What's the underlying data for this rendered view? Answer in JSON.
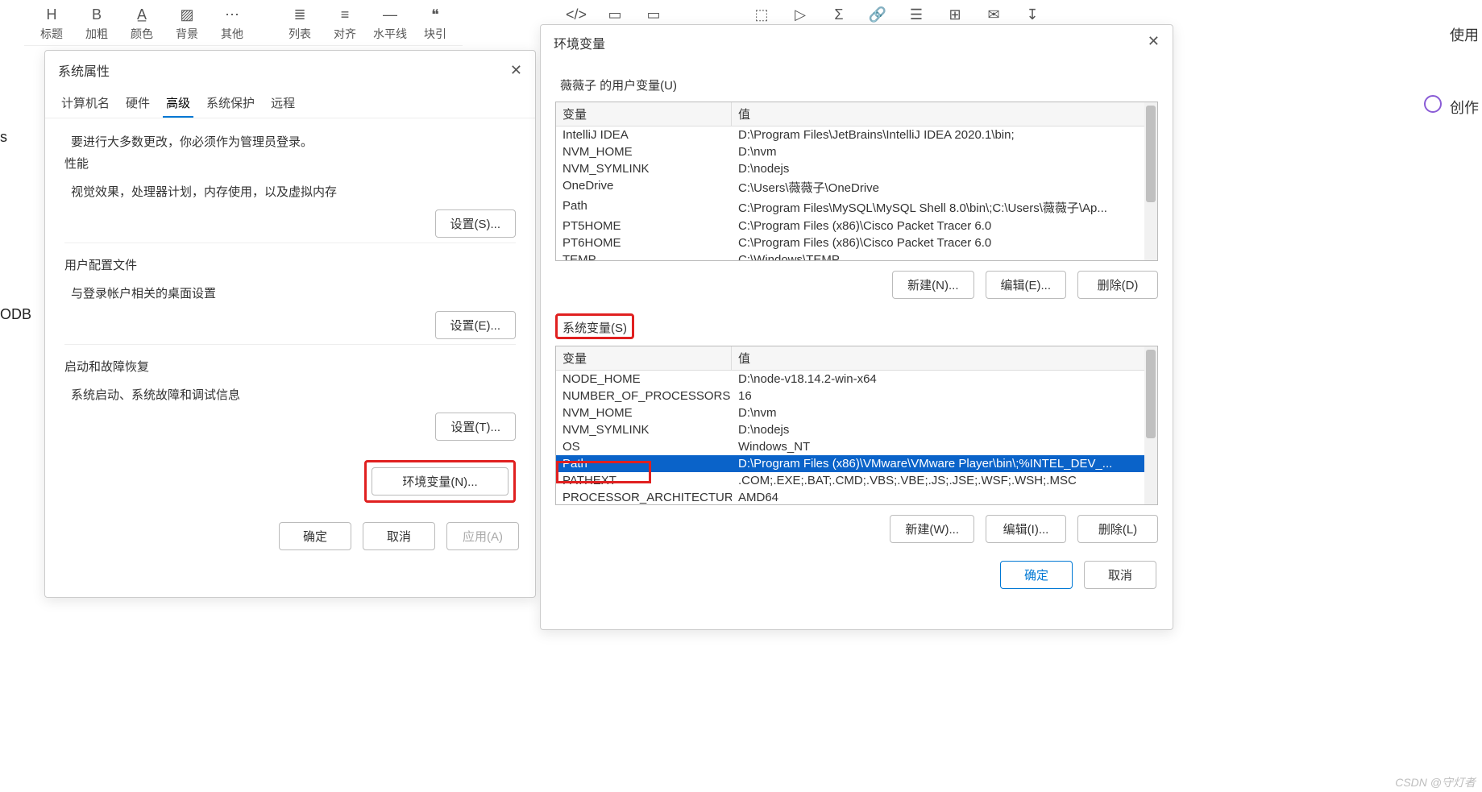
{
  "toolbar_left": [
    {
      "icon": "H",
      "label": "标题"
    },
    {
      "icon": "B",
      "label": "加粗"
    },
    {
      "icon": "A̲",
      "label": "颜色"
    },
    {
      "icon": "▨",
      "label": "背景"
    },
    {
      "icon": "⋯",
      "label": "其他"
    },
    {
      "icon": "≣",
      "label": "列表"
    },
    {
      "icon": "≡",
      "label": "对齐"
    },
    {
      "icon": "―",
      "label": "水平线"
    },
    {
      "icon": "❝",
      "label": "块引"
    }
  ],
  "toolbar_right": [
    {
      "icon": "</>",
      "label": ""
    },
    {
      "icon": "▭",
      "label": ""
    },
    {
      "icon": "▭",
      "label": ""
    },
    {
      "icon": "⬚",
      "label": ""
    },
    {
      "icon": "▷",
      "label": ""
    },
    {
      "icon": "Σ",
      "label": ""
    },
    {
      "icon": "🔗",
      "label": ""
    },
    {
      "icon": "☰",
      "label": ""
    },
    {
      "icon": "⊞",
      "label": ""
    },
    {
      "icon": "✉",
      "label": ""
    },
    {
      "icon": "↧",
      "label": ""
    }
  ],
  "toolbar_far_right": [
    {
      "label": "使用"
    },
    {
      "label": "创作"
    }
  ],
  "left_fragment_s": "s",
  "left_fragment_odb": "ODB",
  "sys_dialog": {
    "title": "系统属性",
    "tabs": [
      "计算机名",
      "硬件",
      "高级",
      "系统保护",
      "远程"
    ],
    "active_tab_index": 2,
    "intro": "要进行大多数更改，你必须作为管理员登录。",
    "perf_title": "性能",
    "perf_desc": "视觉效果，处理器计划，内存使用，以及虚拟内存",
    "perf_btn": "设置(S)...",
    "user_title": "用户配置文件",
    "user_desc": "与登录帐户相关的桌面设置",
    "user_btn": "设置(E)...",
    "boot_title": "启动和故障恢复",
    "boot_desc": "系统启动、系统故障和调试信息",
    "boot_btn": "设置(T)...",
    "env_btn": "环境变量(N)...",
    "ok": "确定",
    "cancel": "取消",
    "apply": "应用(A)"
  },
  "env_dialog": {
    "title": "环境变量",
    "user_section": "薇薇子 的用户变量(U)",
    "sys_section": "系统变量(S)",
    "col_var": "变量",
    "col_val": "值",
    "user_vars": [
      {
        "k": "IntelliJ IDEA",
        "v": "D:\\Program Files\\JetBrains\\IntelliJ IDEA 2020.1\\bin;"
      },
      {
        "k": "NVM_HOME",
        "v": "D:\\nvm"
      },
      {
        "k": "NVM_SYMLINK",
        "v": "D:\\nodejs"
      },
      {
        "k": "OneDrive",
        "v": "C:\\Users\\薇薇子\\OneDrive"
      },
      {
        "k": "Path",
        "v": "C:\\Program Files\\MySQL\\MySQL Shell 8.0\\bin\\;C:\\Users\\薇薇子\\Ap..."
      },
      {
        "k": "PT5HOME",
        "v": "C:\\Program Files (x86)\\Cisco Packet Tracer 6.0"
      },
      {
        "k": "PT6HOME",
        "v": "C:\\Program Files (x86)\\Cisco Packet Tracer 6.0"
      },
      {
        "k": "TEMP",
        "v": "C:\\Windows\\TEMP"
      }
    ],
    "sys_vars": [
      {
        "k": "NODE_HOME",
        "v": "D:\\node-v18.14.2-win-x64"
      },
      {
        "k": "NUMBER_OF_PROCESSORS",
        "v": "16"
      },
      {
        "k": "NVM_HOME",
        "v": "D:\\nvm"
      },
      {
        "k": "NVM_SYMLINK",
        "v": "D:\\nodejs"
      },
      {
        "k": "OS",
        "v": "Windows_NT"
      },
      {
        "k": "Path",
        "v": "D:\\Program Files (x86)\\VMware\\VMware Player\\bin\\;%INTEL_DEV_...",
        "sel": true
      },
      {
        "k": "PATHEXT",
        "v": ".COM;.EXE;.BAT;.CMD;.VBS;.VBE;.JS;.JSE;.WSF;.WSH;.MSC"
      },
      {
        "k": "PROCESSOR_ARCHITECTURE",
        "v": "AMD64"
      }
    ],
    "btn_new": "新建(N)...",
    "btn_edit": "编辑(E)...",
    "btn_del": "删除(D)",
    "btn_new2": "新建(W)...",
    "btn_edit2": "编辑(I)...",
    "btn_del2": "删除(L)",
    "ok": "确定",
    "cancel": "取消"
  },
  "watermark": "CSDN @守灯者"
}
